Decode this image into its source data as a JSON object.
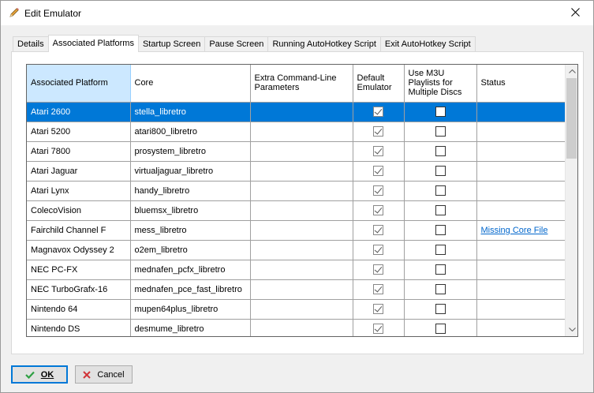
{
  "window": {
    "title": "Edit Emulator",
    "title_icon": "pencil-icon",
    "close_icon": "close-icon"
  },
  "tabs": [
    {
      "label": "Details",
      "active": false
    },
    {
      "label": "Associated Platforms",
      "active": true
    },
    {
      "label": "Startup Screen",
      "active": false
    },
    {
      "label": "Pause Screen",
      "active": false
    },
    {
      "label": "Running AutoHotkey Script",
      "active": false
    },
    {
      "label": "Exit AutoHotkey Script",
      "active": false
    }
  ],
  "grid": {
    "columns": {
      "platform": "Associated Platform",
      "core": "Core",
      "extra": "Extra Command-Line Parameters",
      "default": "Default Emulator",
      "m3u": "Use M3U Playlists for Multiple Discs",
      "status": "Status"
    },
    "rows": [
      {
        "platform": "Atari 2600",
        "core": "stella_libretro",
        "extra": "",
        "default": true,
        "m3u": false,
        "status": ""
      },
      {
        "platform": "Atari 5200",
        "core": "atari800_libretro",
        "extra": "",
        "default": true,
        "m3u": false,
        "status": ""
      },
      {
        "platform": "Atari 7800",
        "core": "prosystem_libretro",
        "extra": "",
        "default": true,
        "m3u": false,
        "status": ""
      },
      {
        "platform": "Atari Jaguar",
        "core": "virtualjaguar_libretro",
        "extra": "",
        "default": true,
        "m3u": false,
        "status": ""
      },
      {
        "platform": "Atari Lynx",
        "core": "handy_libretro",
        "extra": "",
        "default": true,
        "m3u": false,
        "status": ""
      },
      {
        "platform": "ColecoVision",
        "core": "bluemsx_libretro",
        "extra": "",
        "default": true,
        "m3u": false,
        "status": ""
      },
      {
        "platform": "Fairchild Channel F",
        "core": "mess_libretro",
        "extra": "",
        "default": true,
        "m3u": false,
        "status": "Missing Core File"
      },
      {
        "platform": "Magnavox Odyssey 2",
        "core": "o2em_libretro",
        "extra": "",
        "default": true,
        "m3u": false,
        "status": ""
      },
      {
        "platform": "NEC PC-FX",
        "core": "mednafen_pcfx_libretro",
        "extra": "",
        "default": true,
        "m3u": false,
        "status": ""
      },
      {
        "platform": "NEC TurboGrafx-16",
        "core": "mednafen_pce_fast_libretro",
        "extra": "",
        "default": true,
        "m3u": false,
        "status": ""
      },
      {
        "platform": "Nintendo 64",
        "core": "mupen64plus_libretro",
        "extra": "",
        "default": true,
        "m3u": false,
        "status": ""
      },
      {
        "platform": "Nintendo DS",
        "core": "desmume_libretro",
        "extra": "",
        "default": true,
        "m3u": false,
        "status": ""
      }
    ],
    "selected_row": 0
  },
  "buttons": {
    "ok": {
      "label": "OK",
      "icon": "checkmark-icon",
      "accent": "#2ea043"
    },
    "cancel": {
      "label": "Cancel",
      "icon": "x-icon",
      "accent": "#d13438"
    }
  },
  "colors": {
    "selection": "#0078d7",
    "header_selected": "#cce8ff",
    "link": "#0066cc"
  }
}
